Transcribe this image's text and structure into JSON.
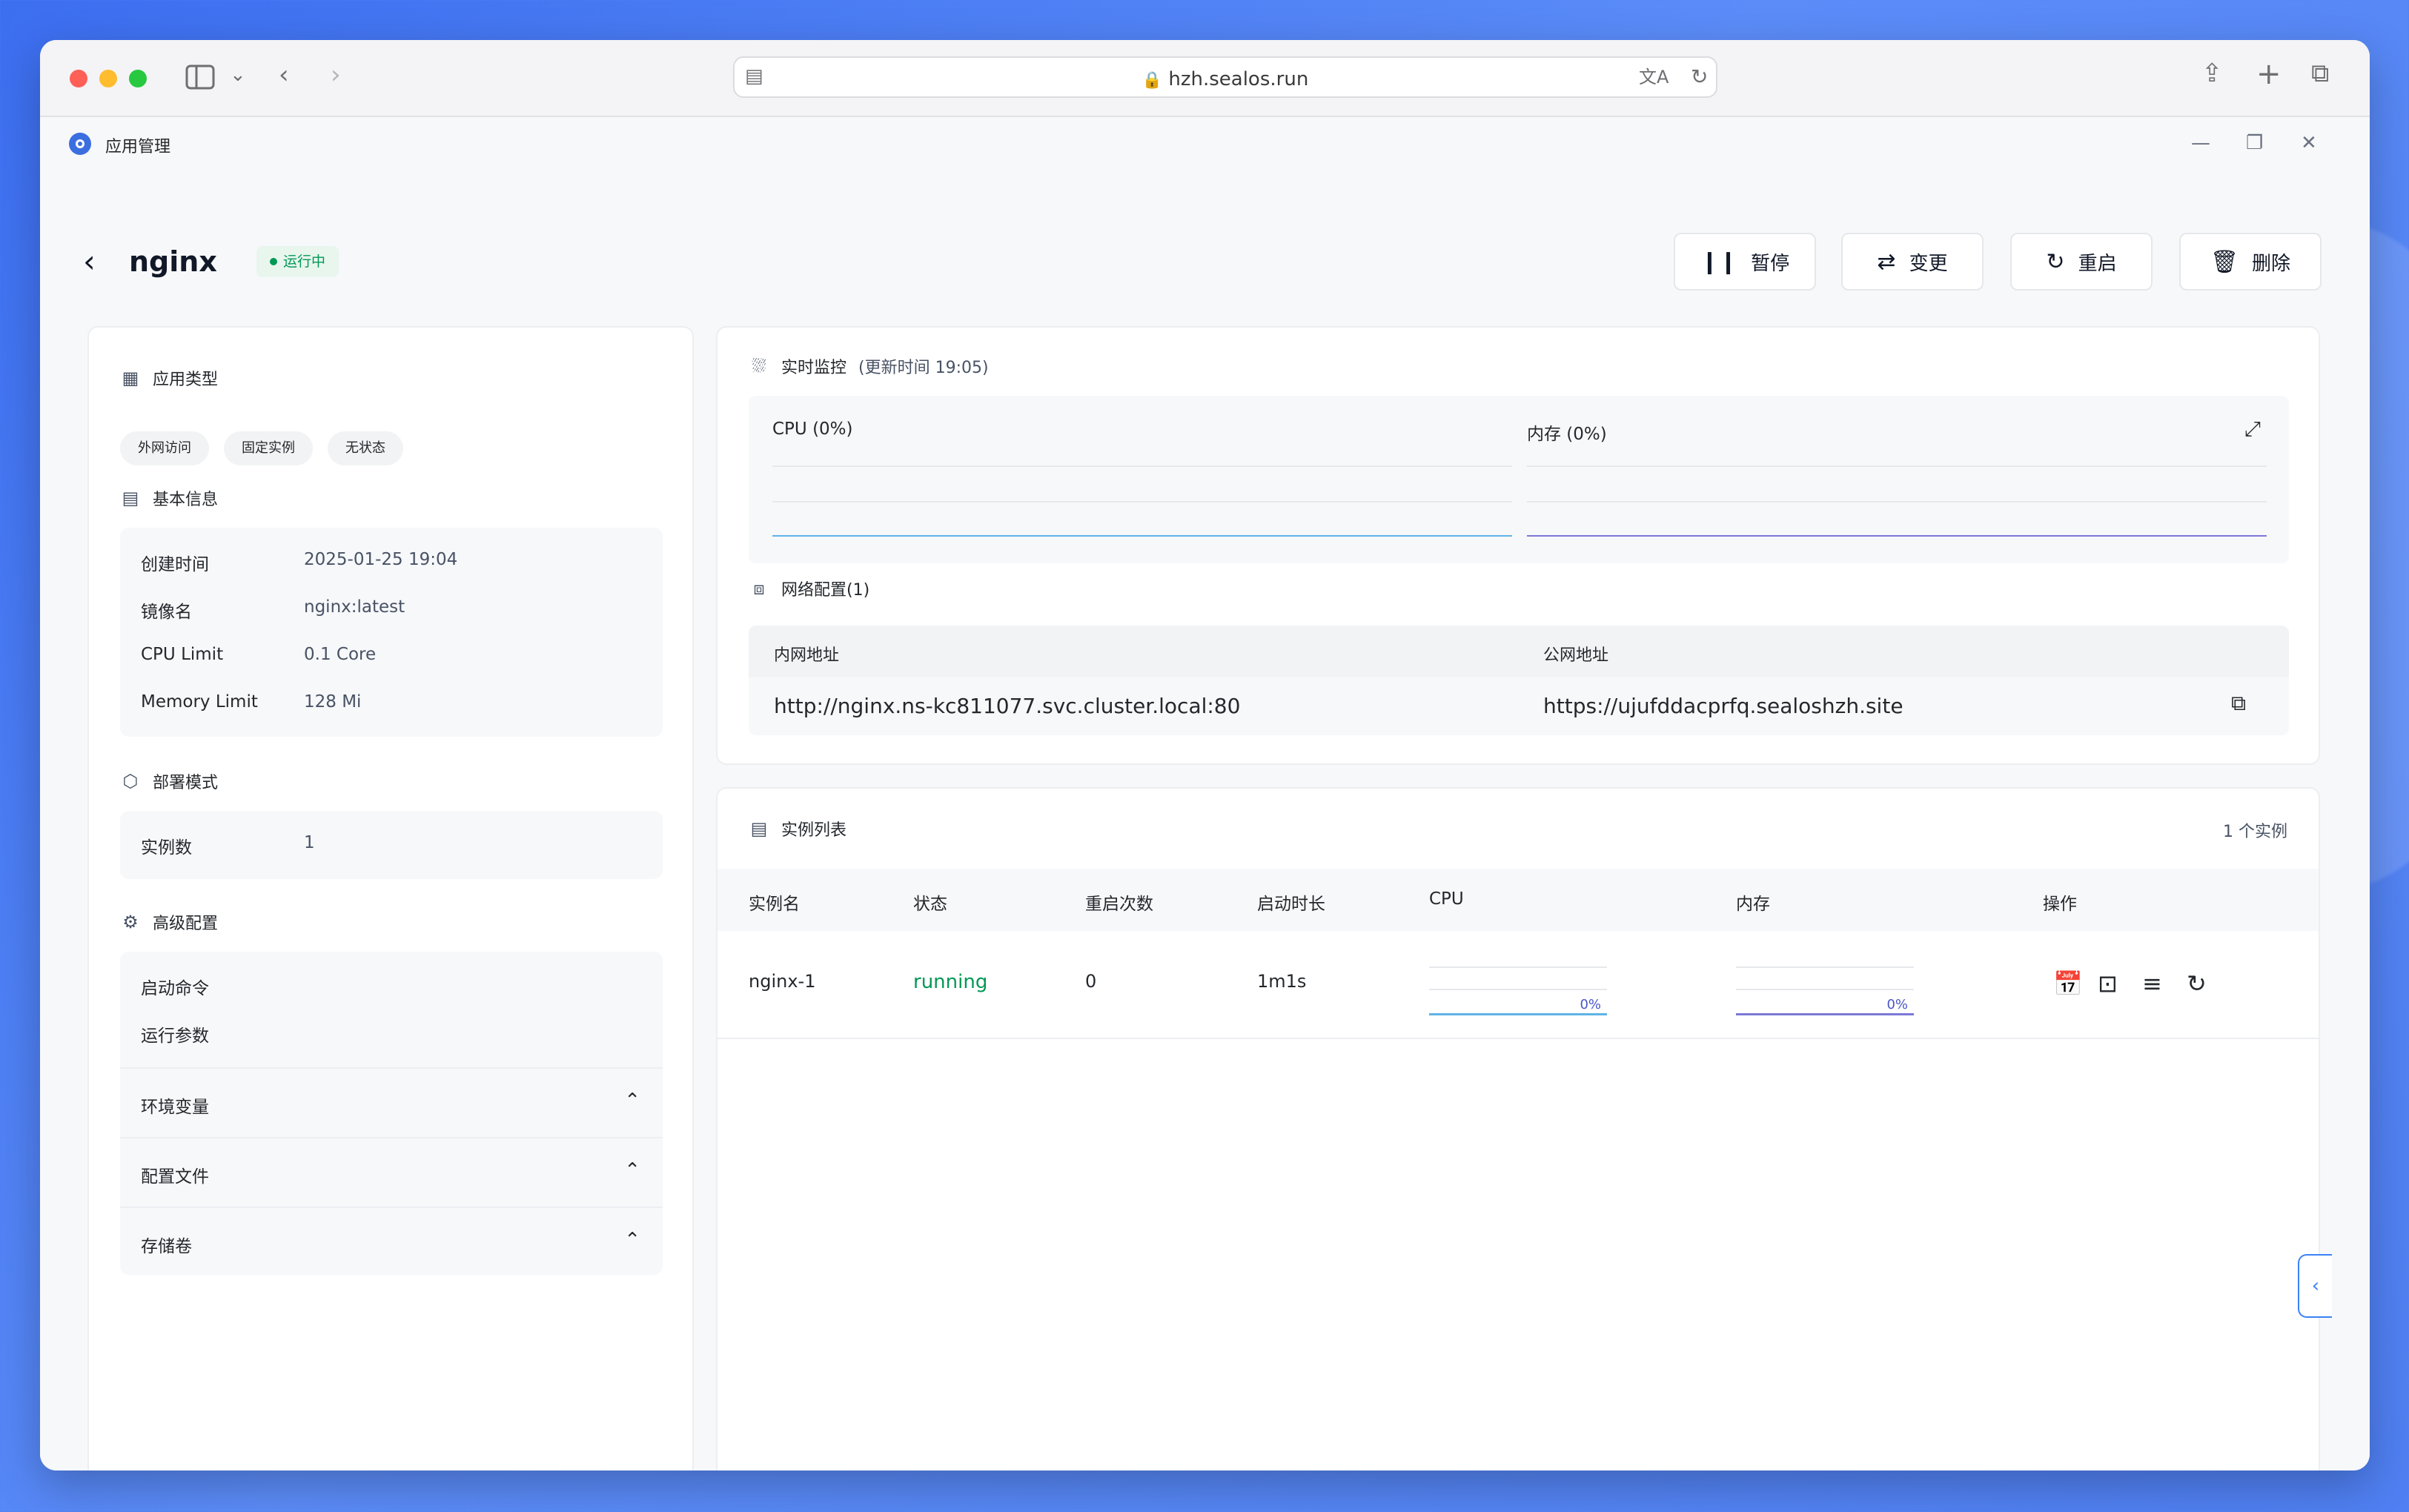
{
  "browser": {
    "url": "hzh.sealos.run"
  },
  "app": {
    "title": "应用管理"
  },
  "header": {
    "app_name": "nginx",
    "status": "运行中",
    "actions": {
      "pause": "暂停",
      "change": "变更",
      "restart": "重启",
      "delete": "删除"
    }
  },
  "left_panel": {
    "app_type": {
      "title": "应用类型",
      "tags": [
        "外网访问",
        "固定实例",
        "无状态"
      ]
    },
    "basic_info": {
      "title": "基本信息",
      "rows": [
        {
          "label": "创建时间",
          "value": "2025-01-25 19:04"
        },
        {
          "label": "镜像名",
          "value": "nginx:latest"
        },
        {
          "label": "CPU Limit",
          "value": "0.1 Core"
        },
        {
          "label": "Memory Limit",
          "value": "128 Mi"
        }
      ]
    },
    "deploy_mode": {
      "title": "部署模式",
      "rows": [
        {
          "label": "实例数",
          "value": "1"
        }
      ]
    },
    "advanced": {
      "title": "高级配置",
      "rows": [
        {
          "label": "启动命令",
          "value": ""
        },
        {
          "label": "运行参数",
          "value": ""
        }
      ],
      "accordions": [
        "环境变量",
        "配置文件",
        "存储卷"
      ]
    }
  },
  "monitor": {
    "title": "实时监控",
    "updated": "(更新时间 19:05)",
    "cpu_label": "CPU  (0%)",
    "mem_label": "内存  (0%)",
    "cpu_color": "#5fb3e6",
    "mem_color": "#7b78d6"
  },
  "network": {
    "title": "网络配置(1)",
    "internal_header": "内网地址",
    "public_header": "公网地址",
    "internal_addr": "http://nginx.ns-kc811077.svc.cluster.local:80",
    "public_addr": "https://ujufddacprfq.sealoshzh.site"
  },
  "instances": {
    "title": "实例列表",
    "count": "1 个实例",
    "columns": [
      "实例名",
      "状态",
      "重启次数",
      "启动时长",
      "CPU",
      "内存",
      "操作"
    ],
    "rows": [
      {
        "name": "nginx-1",
        "status": "running",
        "restarts": "0",
        "uptime": "1m1s",
        "cpu": "0%",
        "mem": "0%"
      }
    ],
    "status_color": "#039855"
  }
}
